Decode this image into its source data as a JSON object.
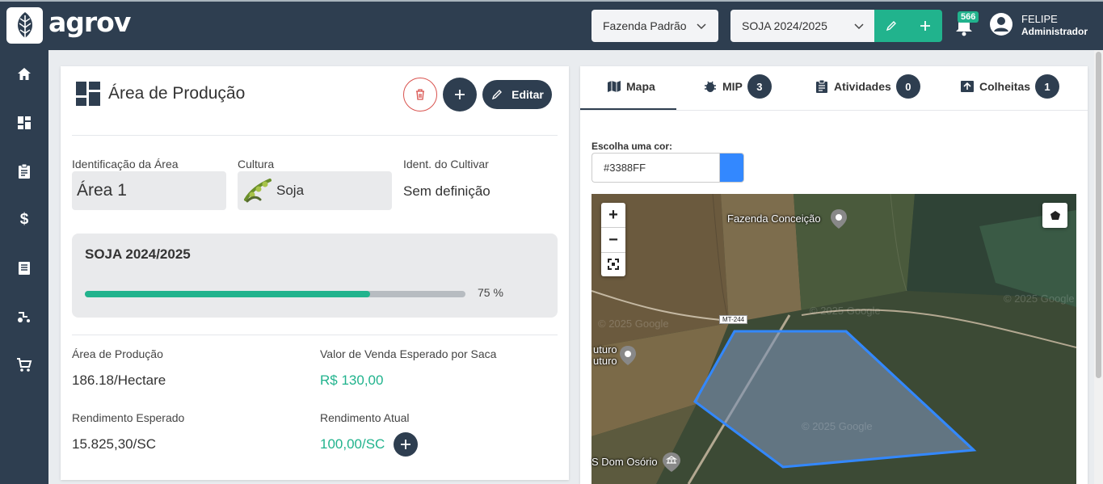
{
  "header": {
    "logo_text": "agrov",
    "farm_select": "Fazenda Padrão",
    "season_select": "SOJA 2024/2025",
    "notifications_count": "566",
    "user_name": "FELIPE",
    "user_role": "Administrador"
  },
  "sidebar": {
    "items": [
      "home-icon",
      "dashboard-icon",
      "clipboard-icon",
      "dollar-icon",
      "book-icon",
      "tractor-icon",
      "cart-icon"
    ]
  },
  "area": {
    "title": "Área de Produção",
    "edit_label": "Editar",
    "ident_label": "Identificação da Área",
    "ident_value": "Área 1",
    "culture_label": "Cultura",
    "culture_value": "Soja",
    "cultivar_label": "Ident. do Cultivar",
    "cultivar_value": "Sem definição",
    "season_title": "SOJA 2024/2025",
    "progress": 75,
    "progress_text": "75 %",
    "area_label": "Área de Produção",
    "area_value": "186.18/Hectare",
    "price_label": "Valor de Venda Esperado por Saca",
    "price_value": "R$ 130,00",
    "expected_yield_label": "Rendimento Esperado",
    "expected_yield_value": "15.825,30/SC",
    "current_yield_label": "Rendimento Atual",
    "current_yield_value": "100,00/SC"
  },
  "tabs": [
    {
      "label": "Mapa",
      "badge": ""
    },
    {
      "label": "MIP",
      "badge": "3"
    },
    {
      "label": "Atividades",
      "badge": "0"
    },
    {
      "label": "Colheitas",
      "badge": "1"
    }
  ],
  "map": {
    "color_label": "Escolha uma cor:",
    "color_value": "#3388FF",
    "polygon_color": "#3388ff",
    "place_1": "Fazenda Conceição",
    "place_2a": "uturo",
    "place_2b": "uturo",
    "place_3": "S Dom Osório",
    "road_tag": "MT-244",
    "watermark": "© 2025 Google"
  },
  "colors": {
    "brand_dark": "#2e3e50",
    "accent_green": "#21b38d",
    "delete_red": "#d9534f"
  }
}
